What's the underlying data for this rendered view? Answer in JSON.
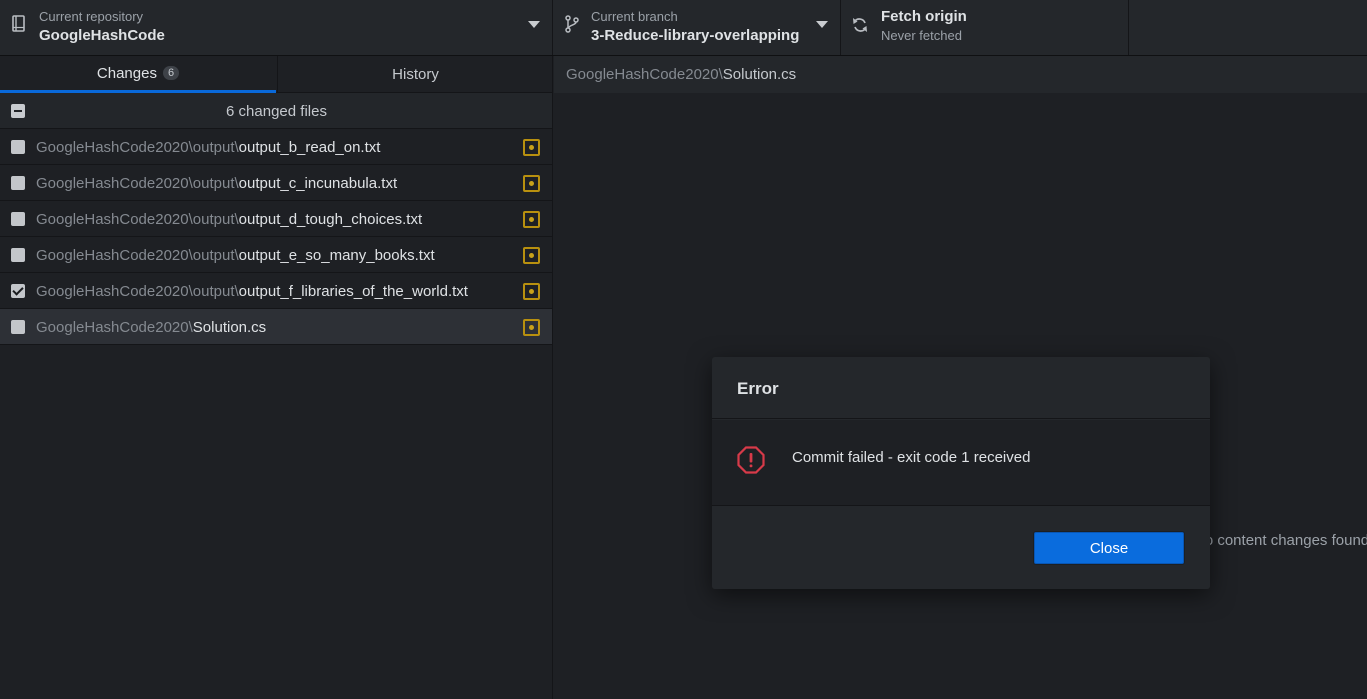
{
  "toolbar": {
    "repo": {
      "label": "Current repository",
      "value": "GoogleHashCode",
      "icon": "repo-icon"
    },
    "branch": {
      "label": "Current branch",
      "value": "3-Reduce-library-overlapping",
      "icon": "branch-icon"
    },
    "fetch": {
      "title": "Fetch origin",
      "subtitle": "Never fetched",
      "icon": "sync-icon"
    }
  },
  "tabs": {
    "changes": {
      "label": "Changes",
      "count": "6"
    },
    "history": {
      "label": "History"
    }
  },
  "changes_header": {
    "title": "6 changed files"
  },
  "files": [
    {
      "dir": "GoogleHashCode2020\\output\\",
      "name": "output_b_read_on.txt",
      "checked": false
    },
    {
      "dir": "GoogleHashCode2020\\output\\",
      "name": "output_c_incunabula.txt",
      "checked": false
    },
    {
      "dir": "GoogleHashCode2020\\output\\",
      "name": "output_d_tough_choices.txt",
      "checked": false
    },
    {
      "dir": "GoogleHashCode2020\\output\\",
      "name": "output_e_so_many_books.txt",
      "checked": false
    },
    {
      "dir": "GoogleHashCode2020\\output\\",
      "name": "output_f_libraries_of_the_world.txt",
      "checked": true
    },
    {
      "dir": "GoogleHashCode2020\\",
      "name": "Solution.cs",
      "checked": false
    }
  ],
  "main": {
    "path_dir": "GoogleHashCode2020\\",
    "path_name": "Solution.cs",
    "empty_text": "No content changes found"
  },
  "dialog": {
    "title": "Error",
    "message": "Commit failed - exit code 1 received",
    "close_label": "Close",
    "icon": "error-octagon-icon"
  },
  "colors": {
    "accent": "#0a6cdd",
    "modified": "#c9a21a",
    "error": "#d73a49"
  }
}
